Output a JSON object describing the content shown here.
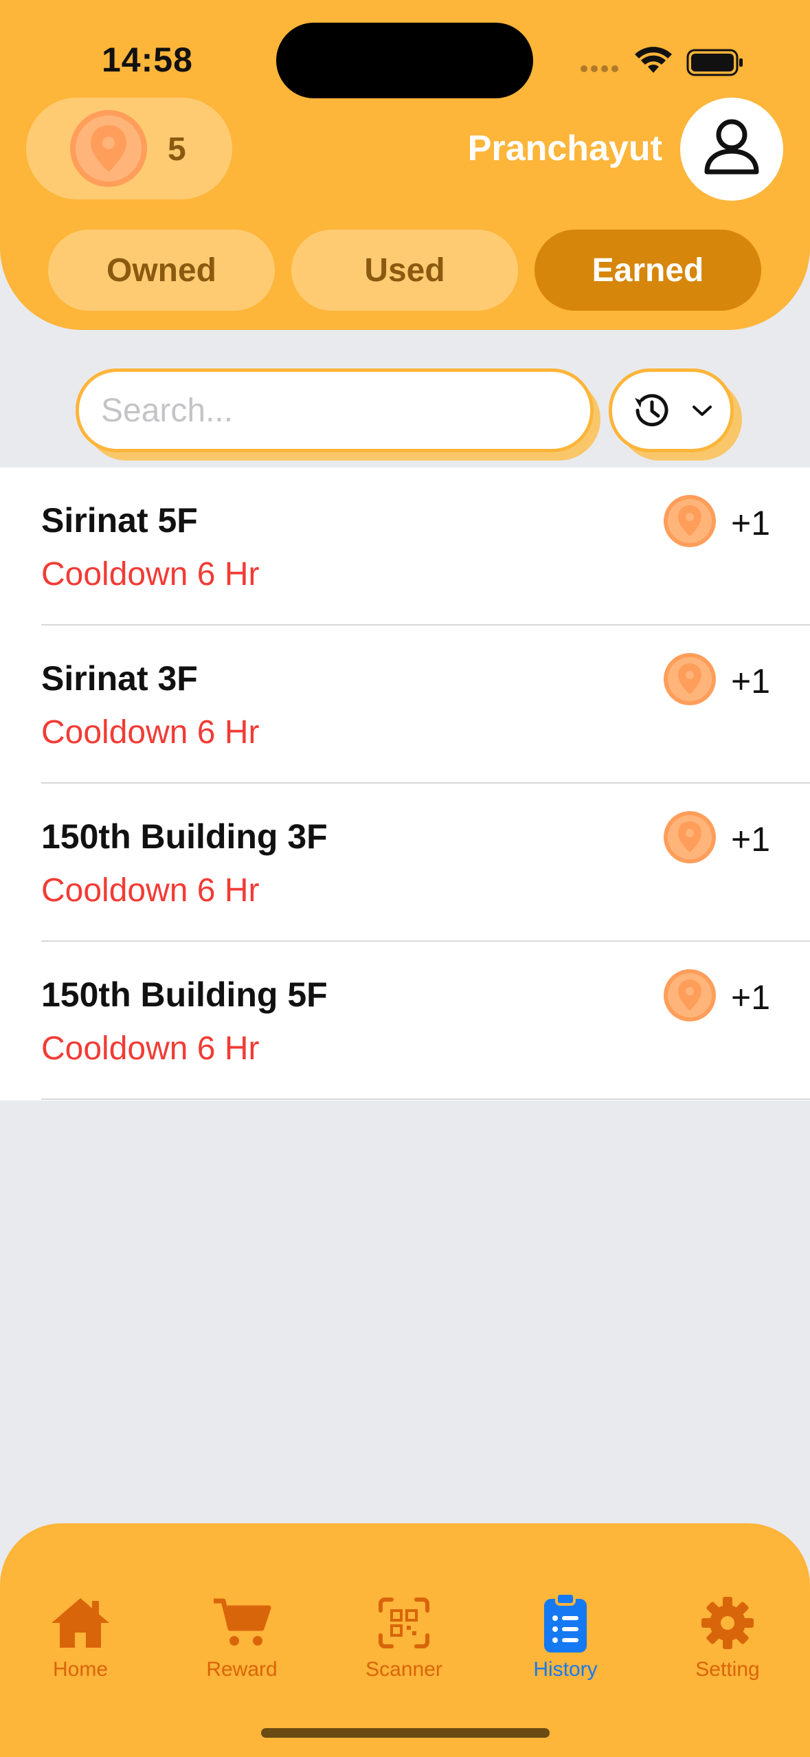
{
  "status_bar": {
    "time": "14:58"
  },
  "header": {
    "points": "5",
    "username": "Pranchayut",
    "segments": [
      {
        "label": "Owned",
        "active": false
      },
      {
        "label": "Used",
        "active": false
      },
      {
        "label": "Earned",
        "active": true
      }
    ]
  },
  "search": {
    "placeholder": "Search...",
    "value": ""
  },
  "list": {
    "items": [
      {
        "title": "Sirinat 5F",
        "subtitle": "Cooldown 6 Hr",
        "points": "+1"
      },
      {
        "title": "Sirinat 3F",
        "subtitle": "Cooldown 6 Hr",
        "points": "+1"
      },
      {
        "title": "150th Building 3F",
        "subtitle": "Cooldown 6 Hr",
        "points": "+1"
      },
      {
        "title": "150th Building 5F",
        "subtitle": "Cooldown 6 Hr",
        "points": "+1"
      }
    ]
  },
  "tabbar": {
    "tabs": [
      {
        "label": "Home",
        "icon": "home-icon",
        "active": false
      },
      {
        "label": "Reward",
        "icon": "cart-icon",
        "active": false
      },
      {
        "label": "Scanner",
        "icon": "qr-scanner-icon",
        "active": false
      },
      {
        "label": "History",
        "icon": "clipboard-list-icon",
        "active": true
      },
      {
        "label": "Setting",
        "icon": "gear-icon",
        "active": false
      }
    ]
  },
  "colors": {
    "header_bg": "#FDB53A",
    "segment_bg": "#FECB72",
    "segment_active_bg": "#D6860A",
    "subtitle_red": "#F23B35",
    "pin_orange": "#FF9E5A",
    "tab_inactive": "#D9650A",
    "tab_active": "#1479F2",
    "page_bg": "#E9EAEE"
  }
}
